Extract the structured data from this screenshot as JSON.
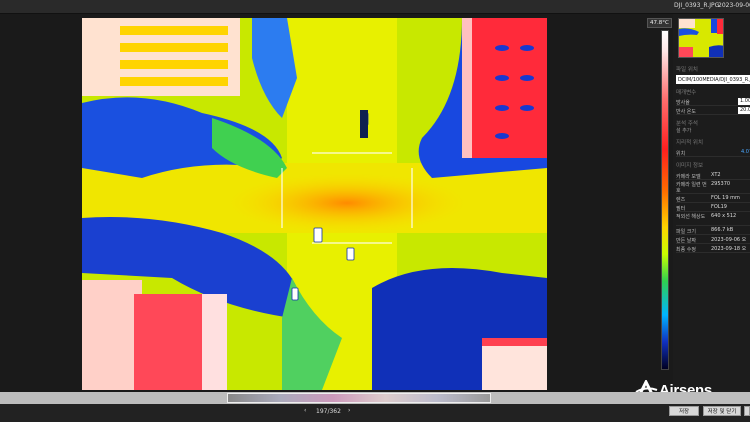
{
  "titlebar": {
    "filename": "DJI_0393_R.JPG",
    "date": "2023-09-06"
  },
  "colors": {
    "accent": "#4aa8ff",
    "background": "#1a1a1a",
    "panel": "#1c1c1c"
  },
  "scale": {
    "max_label": "47.8°C"
  },
  "panel": {
    "file_section": "파일 위치",
    "file_path": "DCIM/100MEDIA/DJI_0393_R.JPG",
    "params_section": "매개변수",
    "params": [
      {
        "label": "방사율",
        "value": "1.00"
      },
      {
        "label": "반사 온도",
        "value": "20.0"
      }
    ],
    "notes_section": "분석 주석",
    "notes_add": "설 추가",
    "gps_section": "지리적 위치",
    "gps": {
      "label": "위치",
      "value": "4.07"
    },
    "image_section": "이미지 정보",
    "info": [
      {
        "label": "카메라 모델",
        "value": "XT2"
      },
      {
        "label": "카메라 일련 번호",
        "value": "295370"
      },
      {
        "label": "렌즈",
        "value": "FOL 19 mm"
      },
      {
        "label": "필터",
        "value": "FOL19"
      },
      {
        "label": "적외선 해상도",
        "value": "640 x 512"
      },
      {
        "label": "파일 크기",
        "value": "866.7 kB"
      },
      {
        "label": "만든 날짜",
        "value": "2023-09-06 오"
      },
      {
        "label": "최종 수정",
        "value": "2023-09-18 오"
      }
    ]
  },
  "pager": {
    "prev": "‹",
    "next": "›",
    "text": "197/362"
  },
  "buttons": {
    "save": "저장",
    "save_close": "저장 및 닫기"
  },
  "logo": {
    "text": "Airsens",
    "icon": "airsens-logo-icon"
  }
}
